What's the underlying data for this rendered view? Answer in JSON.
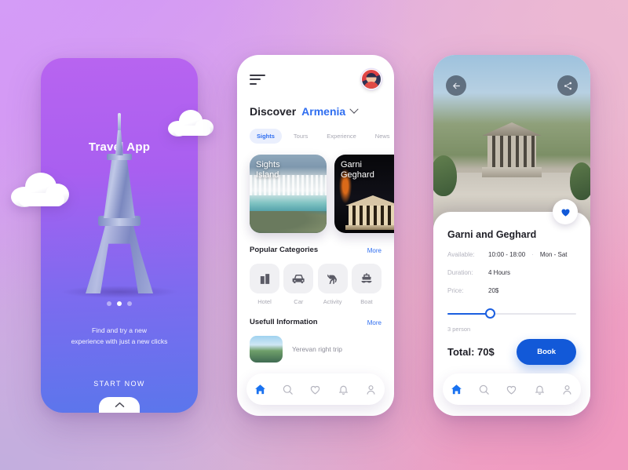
{
  "background": {
    "top_left": "#d08ef5",
    "top_right": "#edb9d2",
    "bottom_left": "#c2aede",
    "bottom_right": "#f09ac0"
  },
  "accent": {
    "blue": "#2f6ef0",
    "book_blue": "#1259d8",
    "purple": "#a95ff0"
  },
  "onboarding": {
    "title": "Travel App",
    "subtitle_line1": "Find and try a new",
    "subtitle_line2": "experience with just a new clicks",
    "cta_label": "START NOW",
    "dots": [
      false,
      true,
      false
    ],
    "chevron_icon": "chevron-up-icon",
    "tower_icon": "eiffel-tower-illustration",
    "cloud_icon": "cloud-illustration"
  },
  "discover": {
    "menu_icon": "hamburger-menu-icon",
    "avatar_icon": "user-avatar",
    "heading_label": "Discover",
    "location": "Armenia",
    "location_chevron_icon": "chevron-down-icon",
    "tabs": [
      {
        "label": "Sights",
        "active": true
      },
      {
        "label": "Tours",
        "active": false
      },
      {
        "label": "Experience",
        "active": false
      },
      {
        "label": "News",
        "active": false
      }
    ],
    "cards": [
      {
        "title_line1": "Sights",
        "title_line2": "Island",
        "image": "waterfall-photo"
      },
      {
        "title_line1": "Garni",
        "title_line2": "Geghard",
        "image": "temple-night-photo"
      }
    ],
    "categories_section": {
      "title": "Popular Categories",
      "more_label": "More"
    },
    "categories": [
      {
        "label": "Hotel",
        "icon": "hotel-icon"
      },
      {
        "label": "Car",
        "icon": "car-icon"
      },
      {
        "label": "Activity",
        "icon": "horse-icon"
      },
      {
        "label": "Boat",
        "icon": "boat-icon"
      }
    ],
    "info_section": {
      "title": "Usefull Information",
      "more_label": "More"
    },
    "info_items": [
      {
        "label": "Yerevan right trip",
        "thumb": "yerevan-photo"
      }
    ]
  },
  "detail": {
    "back_icon": "arrow-left-icon",
    "share_icon": "share-icon",
    "favorite_icon": "heart-filled-icon",
    "hero_image": "garni-temple-photo",
    "title": "Garni and Geghard",
    "fields": [
      {
        "key": "Available:",
        "value": "10:00 - 18:00",
        "separator": "·",
        "value2": "Mon - Sat"
      },
      {
        "key": "Duration:",
        "value": "4 Hours"
      },
      {
        "key": "Price:",
        "value": "20$"
      }
    ],
    "slider": {
      "percent": 33,
      "persons_label": "3 person"
    },
    "total_label": "Total: 70$",
    "book_label": "Book"
  },
  "navbar": {
    "items": [
      {
        "icon": "home-icon",
        "active": true
      },
      {
        "icon": "search-icon",
        "active": false
      },
      {
        "icon": "heart-icon",
        "active": false
      },
      {
        "icon": "bell-icon",
        "active": false
      },
      {
        "icon": "person-icon",
        "active": false
      }
    ]
  }
}
